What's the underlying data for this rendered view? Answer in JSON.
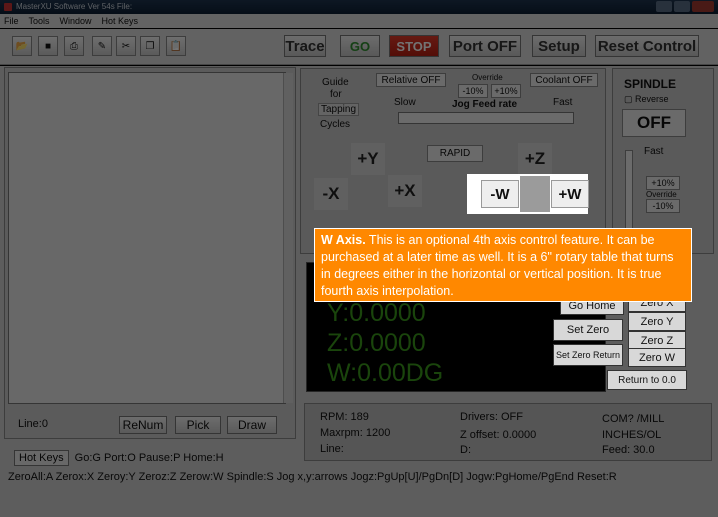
{
  "window": {
    "title": "MasterXU Software Ver 54s File:"
  },
  "menu": [
    "File",
    "Tools",
    "Window",
    "Hot Keys"
  ],
  "toolbar": {
    "trace": "Trace",
    "go": "GO",
    "stop": "STOP",
    "port_off": "Port OFF",
    "setup": "Setup",
    "reset_control": "Reset Control"
  },
  "left_panel": {
    "line": "Line:0",
    "renum": "ReNum",
    "pick": "Pick",
    "draw": "Draw"
  },
  "controls": {
    "guide_for_tapping_cycles": [
      "Guide",
      "for",
      "Tapping",
      "Cycles"
    ],
    "relative_off": "Relative OFF",
    "override": "Override",
    "minus10": "-10%",
    "plus10": "+10%",
    "coolant_off": "Coolant OFF",
    "slow": "Slow",
    "jog_feed_rate": "Jog Feed rate",
    "fast": "Fast",
    "rapid": "RAPID",
    "plus_y": "+Y",
    "minus_x": "-X",
    "plus_x": "+X",
    "plus_z": "+Z",
    "minus_w": "-W",
    "plus_w": "+W"
  },
  "spindle": {
    "title": "SPINDLE",
    "reverse": "Reverse",
    "off": "OFF",
    "fast": "Fast",
    "plus10": "+10%",
    "override": "Override",
    "minus10": "-10%"
  },
  "dro": {
    "y": "Y:0.0000",
    "z": "Z:0.0000",
    "w": "W:0.00DG",
    "go_home": "Go Home",
    "zero_x": "Zero X",
    "zero_y": "Zero Y",
    "zero_z": "Zero Z",
    "zero_w": "Zero W",
    "set_zero": "Set Zero",
    "set_zero_return": "Set Zero Return",
    "return_to_zero": "Return to 0.0"
  },
  "status": {
    "rpm": "RPM: 189",
    "maxrpm": "Maxrpm: 1200",
    "line": "Line:",
    "drivers": "Drivers: OFF",
    "z_offset": "Z offset: 0.0000",
    "d": "D:",
    "com": "COM? /MILL",
    "units": "INCHES/OL",
    "feed": "Feed: 30.0"
  },
  "hotkeys": {
    "button": "Hot Keys",
    "row1": "Go:G  Port:O  Pause:P  Home:H",
    "row2": "ZeroAll:A  Zerox:X  Zeroy:Y  Zeroz:Z  Zerow:W  Spindle:S  Jog x,y:arrows  Jogz:PgUp[U]/PgDn[D]  Jogw:PgHome/PgEnd  Reset:R"
  },
  "tooltip": {
    "heading": "W Axis.",
    "body": " This is an optional 4th axis control feature. It can be purchased at a later time as well. It is a 6\" rotary table that turns in degrees either in the horizontal or vertical position. It is true fourth axis interpolation."
  }
}
